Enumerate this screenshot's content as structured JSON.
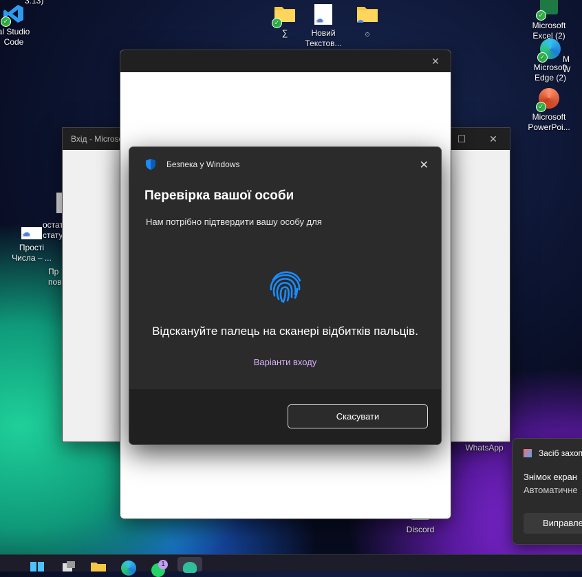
{
  "desktop": {
    "icons": [
      {
        "label_lines": [
          "3.13)"
        ],
        "icon": "python-icon"
      },
      {
        "label_lines": [
          "al Studio",
          "Code"
        ],
        "icon": "vscode-icon"
      },
      {
        "label_lines": [
          "∑"
        ],
        "icon": "folder-icon"
      },
      {
        "label_lines": [
          "Новий",
          "Текстов..."
        ],
        "icon": "text-file-icon"
      },
      {
        "label_lines": [
          "۞"
        ],
        "icon": "folder-icon"
      },
      {
        "label_lines": [
          "Microsoft",
          "Excel (2)"
        ],
        "icon": "excel-icon"
      },
      {
        "label_lines": [
          "Microsoft",
          "Edge (2)"
        ],
        "icon": "edge-icon"
      },
      {
        "label_lines": [
          "Microsoft",
          "PowerPoi..."
        ],
        "icon": "powerpoint-icon"
      },
      {
        "label_lines": [
          "M",
          "W"
        ],
        "icon": "word-icon"
      },
      {
        "label_lines": [
          "Прості",
          "Числа – ..."
        ],
        "icon": "document-icon"
      },
      {
        "label_lines": [
          "остат",
          "стату"
        ],
        "icon": "document-icon"
      },
      {
        "label_lines": [
          "Пр",
          "пов"
        ],
        "icon": "document-icon"
      },
      {
        "label_lines": [
          "WhatsApp"
        ],
        "icon": "whatsapp-icon"
      },
      {
        "label_lines": [
          "Discord"
        ],
        "icon": "discord-icon"
      }
    ]
  },
  "background_window": {
    "title": "Вхід - Microso"
  },
  "dialog": {
    "app_name": "Безпека у Windows",
    "heading": "Перевірка вашої особи",
    "description": "Нам потрібно підтвердити вашу особу для",
    "instruction": "Відскануйте палець на сканері відбитків пальців.",
    "options_link": "Варіанти входу",
    "cancel_label": "Скасувати",
    "accent_color": "#1a8cff",
    "link_color": "#d9b3ff"
  },
  "toast": {
    "app_name": "Засіб захоп",
    "title": "Знімок екран",
    "body": "Автоматичне",
    "action_label": "Виправле"
  },
  "taskbar": {
    "whatsapp_badge": "1",
    "icons": [
      "start-icon",
      "task-view-icon",
      "file-explorer-icon",
      "edge-icon",
      "whatsapp-icon",
      "game-icon"
    ]
  }
}
